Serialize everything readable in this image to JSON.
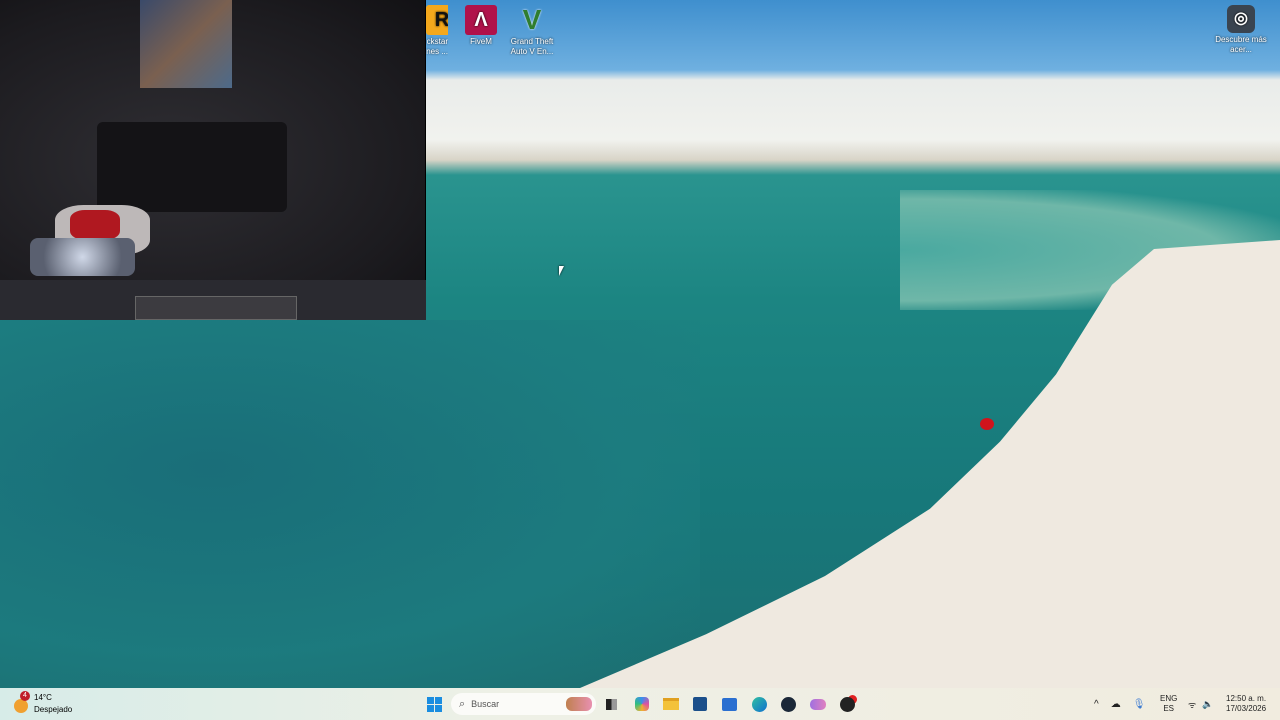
{
  "desktop": {
    "icons": [
      {
        "label": "Rockstar Games...",
        "label_visible": "ckstar\nnes ...",
        "icon": "rockstar-icon",
        "color": "#f4a81c"
      },
      {
        "label": "FiveM",
        "icon": "fivem-icon",
        "color": "#b0124a"
      },
      {
        "label": "Grand Theft Auto V En...",
        "icon": "gta-v-icon",
        "color": "#2f7d2f"
      },
      {
        "label": "Descubre más acer...",
        "icon": "spotlight-icon",
        "color": "#3a4450"
      }
    ]
  },
  "webcam": {
    "label": "webcam-overlay"
  },
  "taskbar": {
    "weather": {
      "temp": "14°C",
      "condition": "Despejado",
      "badge": "4"
    },
    "search_placeholder": "Buscar",
    "apps": [
      "task-view",
      "copilot",
      "file-explorer",
      "microsoft-store",
      "outlook",
      "edge",
      "steam",
      "game-bar",
      "recording-app"
    ],
    "tray": {
      "lang": "ENG",
      "layout": "ES",
      "time": "12:50 a. m.",
      "date": "17/03/2026"
    }
  }
}
